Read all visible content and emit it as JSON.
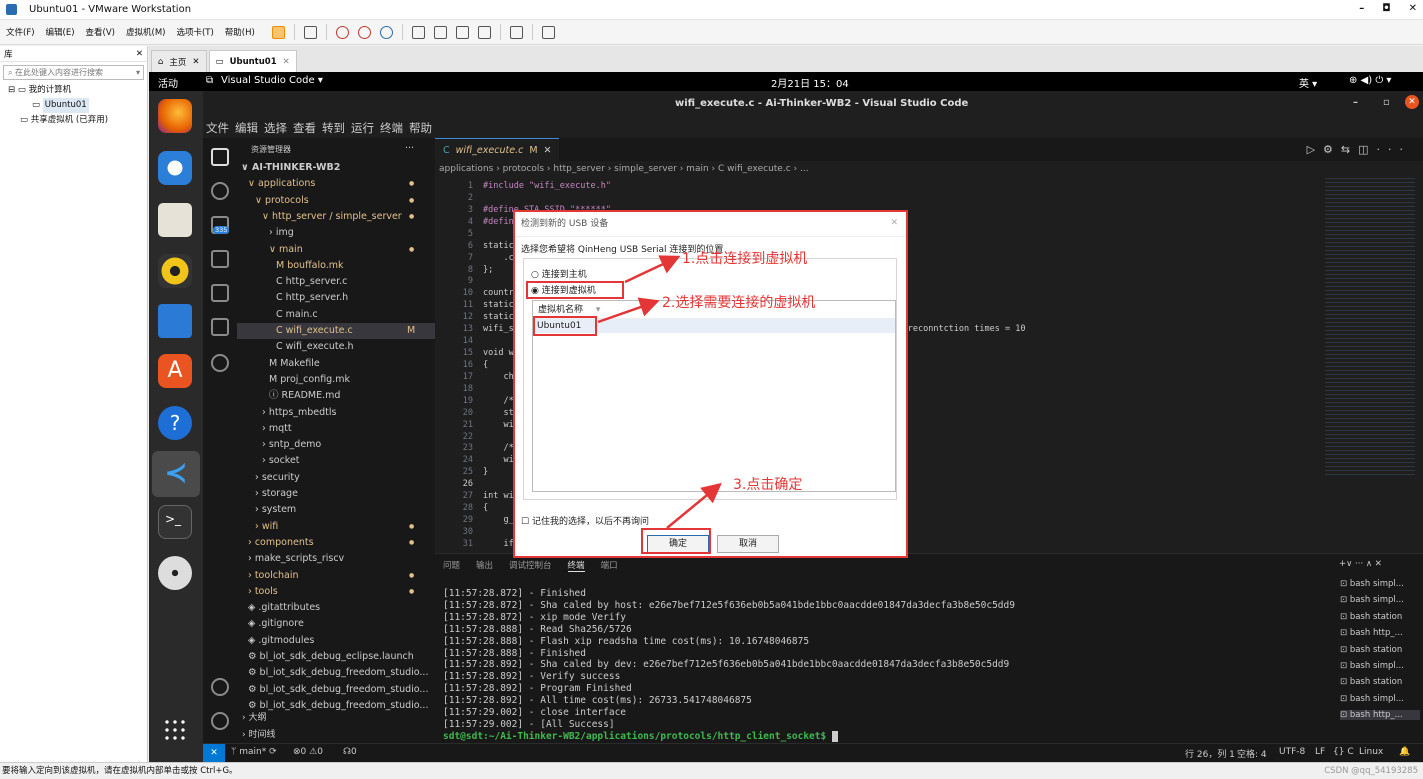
{
  "vm": {
    "title": "Ubuntu01 - VMware Workstation",
    "win_min": "–",
    "win_max": "◘",
    "win_close": "✕",
    "menu": [
      "文件(F)",
      "编辑(E)",
      "查看(V)",
      "虚拟机(M)",
      "选项卡(T)",
      "帮助(H)"
    ],
    "library": {
      "title": "库",
      "close": "✕",
      "search_placeholder": "在此处键入内容进行搜索",
      "tree": [
        "我的计算机",
        "Ubuntu01",
        "共享虚拟机 (已弃用)"
      ]
    },
    "tabs": [
      {
        "label": "主页",
        "close": "✕"
      },
      {
        "label": "Ubuntu01",
        "close": "✕"
      }
    ],
    "status": "要将输入定向到该虚拟机，请在虚拟机内部单击或按 Ctrl+G。",
    "watermark": "CSDN @qq_54193285"
  },
  "ubuntu": {
    "activities": "活动",
    "app": "Visual Studio Code ▾",
    "clock": "2月21日 15：04",
    "lang": "英 ▾",
    "tray": "⊕  ◀)  ⏻ ▾",
    "badge": "335"
  },
  "vscode": {
    "title": "wifi_execute.c - Ai-Thinker-WB2 - Visual Studio Code",
    "menu": [
      "文件",
      "编辑",
      "选择",
      "查看",
      "转到",
      "运行",
      "终端",
      "帮助"
    ],
    "explorer_header": "资源管理器",
    "explorer_more": "···",
    "tree": [
      {
        "t": "∨ AI-THINKER-WB2",
        "d": 0,
        "bold": true
      },
      {
        "t": "∨ applications",
        "d": 1,
        "dot": true,
        "c": "#e2c08d"
      },
      {
        "t": "∨ protocols",
        "d": 2,
        "dot": true,
        "c": "#e2c08d"
      },
      {
        "t": "∨ http_server / simple_server",
        "d": 3,
        "dot": true,
        "c": "#e2c08d"
      },
      {
        "t": "› img",
        "d": 4
      },
      {
        "t": "∨ main",
        "d": 4,
        "dot": true,
        "c": "#e2c08d"
      },
      {
        "t": "M  bouffalo.mk",
        "d": 5,
        "c": "#e2c08d"
      },
      {
        "t": "C  http_server.c",
        "d": 5
      },
      {
        "t": "C  http_server.h",
        "d": 5
      },
      {
        "t": "C  main.c",
        "d": 5
      },
      {
        "t": "C  wifi_execute.c",
        "d": 5,
        "c": "#e2c08d",
        "m": "M",
        "sel": true
      },
      {
        "t": "C  wifi_execute.h",
        "d": 5
      },
      {
        "t": "M  Makefile",
        "d": 4
      },
      {
        "t": "M  proj_config.mk",
        "d": 4
      },
      {
        "t": "ⓘ  README.md",
        "d": 4
      },
      {
        "t": "› https_mbedtls",
        "d": 3
      },
      {
        "t": "› mqtt",
        "d": 3
      },
      {
        "t": "› sntp_demo",
        "d": 3
      },
      {
        "t": "› socket",
        "d": 3
      },
      {
        "t": "› security",
        "d": 2
      },
      {
        "t": "› storage",
        "d": 2
      },
      {
        "t": "› system",
        "d": 2
      },
      {
        "t": "› wifi",
        "d": 2,
        "dot": true,
        "c": "#e2c08d"
      },
      {
        "t": "› components",
        "d": 1,
        "dot": true,
        "c": "#e2c08d"
      },
      {
        "t": "› make_scripts_riscv",
        "d": 1
      },
      {
        "t": "› toolchain",
        "d": 1,
        "dot": true,
        "c": "#e2c08d"
      },
      {
        "t": "› tools",
        "d": 1,
        "dot": true,
        "c": "#e2c08d"
      },
      {
        "t": "◈  .gitattributes",
        "d": 1
      },
      {
        "t": "◈  .gitignore",
        "d": 1
      },
      {
        "t": "◈  .gitmodules",
        "d": 1
      },
      {
        "t": "⚙  bl_iot_sdk_debug_eclipse.launch",
        "d": 1
      },
      {
        "t": "⚙  bl_iot_sdk_debug_freedom_studio...",
        "d": 1
      },
      {
        "t": "⚙  bl_iot_sdk_debug_freedom_studio...",
        "d": 1
      },
      {
        "t": "⚙  bl_iot_sdk_debug_freedom_studio...",
        "d": 1
      }
    ],
    "outline": "› 大纲",
    "timeline": "› 时间线",
    "tab": {
      "label": "wifi_execute.c",
      "mod": "M",
      "close": "✕"
    },
    "breadcrumb": "applications › protocols › http_server › simple_server › main › C  wifi_execute.c › ...",
    "code": [
      {
        "n": "1",
        "t": "#include \"wifi_execute.h\""
      },
      {
        "n": "2",
        "t": ""
      },
      {
        "n": "3",
        "t": "#define STA_SSID \"******\""
      },
      {
        "n": "4",
        "t": "#define"
      },
      {
        "n": "5",
        "t": ""
      },
      {
        "n": "6",
        "t": "static"
      },
      {
        "n": "7",
        "t": "    .co"
      },
      {
        "n": "8",
        "t": "};"
      },
      {
        "n": "9",
        "t": ""
      },
      {
        "n": "10",
        "t": "country"
      },
      {
        "n": "11",
        "t": "static"
      },
      {
        "n": "12",
        "t": "static"
      },
      {
        "n": "13",
        "t": "wifi_st                                                                          , reconntction times = 10"
      },
      {
        "n": "14",
        "t": ""
      },
      {
        "n": "15",
        "t": "void wi"
      },
      {
        "n": "16",
        "t": "{"
      },
      {
        "n": "17",
        "t": "    cha"
      },
      {
        "n": "18",
        "t": ""
      },
      {
        "n": "19",
        "t": "    /*"
      },
      {
        "n": "20",
        "t": "    str"
      },
      {
        "n": "21",
        "t": "    wif"
      },
      {
        "n": "22",
        "t": ""
      },
      {
        "n": "23",
        "t": "    /*"
      },
      {
        "n": "24",
        "t": "    wif"
      },
      {
        "n": "25",
        "t": "}"
      },
      {
        "n": "26",
        "t": ""
      },
      {
        "n": "27",
        "t": "int wif"
      },
      {
        "n": "28",
        "t": "{"
      },
      {
        "n": "29",
        "t": "    g_w"
      },
      {
        "n": "30",
        "t": ""
      },
      {
        "n": "31",
        "t": "    if"
      }
    ],
    "panel_tabs": [
      "问题",
      "输出",
      "调试控制台",
      "终端",
      "端口"
    ],
    "panel_controls": "+∨  ···  ∧  ✕",
    "terminal": [
      "[11:57:28.872] - Finished",
      "[11:57:28.872] - Sha caled by host: e26e7bef712e5f636eb0b5a041bde1bbc0aacdde01847da3decfa3b8e50c5dd9",
      "[11:57:28.872] - xip mode Verify",
      "[11:57:28.888] - Read Sha256/5726",
      "[11:57:28.888] - Flash xip readsha time cost(ms): 10.16748046875",
      "[11:57:28.888] - Finished",
      "[11:57:28.892] - Sha caled by dev: e26e7bef712e5f636eb0b5a041bde1bbc0aacdde01847da3decfa3b8e50c5dd9",
      "[11:57:28.892] - Verify success",
      "[11:57:28.892] - Program Finished",
      "[11:57:28.892] - All time cost(ms): 26733.541748046875",
      "[11:57:29.002] - close interface",
      "[11:57:29.002] - [All Success]"
    ],
    "prompt": "sdt@sdt:~/Ai-Thinker-WB2/applications/protocols/http_client_socket$ ",
    "terminals": [
      "bash simpl...",
      "bash simpl...",
      "bash station",
      "bash http_...",
      "bash station",
      "bash simpl...",
      "bash station",
      "bash simpl...",
      "bash http_..."
    ],
    "status_left": [
      "✕",
      "ᛘ main* ⟳",
      "⊗0 ⚠0",
      "☊0"
    ],
    "status_right": [
      "行 26，列 1",
      "空格: 4",
      "UTF-8",
      "LF",
      "{} C",
      "Linux",
      "🔔"
    ]
  },
  "dialog": {
    "title": "检测到新的 USB 设备",
    "close": "✕",
    "prompt": "选择您希望将 QinHeng USB Serial 连接到的位置",
    "opt_host": "连接到主机",
    "opt_vm": "连接到虚拟机",
    "col_header": "虚拟机名称",
    "vm_item": "Ubuntu01",
    "remember": "记住我的选择，以后不再询问",
    "ok": "确定",
    "cancel": "取消"
  },
  "annotations": {
    "a1": "1.点击连接到虚拟机",
    "a2": "2.选择需要连接的虚拟机",
    "a3": "3.点击确定"
  },
  "colors": {
    "annotation": "#e43636",
    "vscode_bg": "#1e1e1e",
    "dock": "#2a2a2a"
  }
}
